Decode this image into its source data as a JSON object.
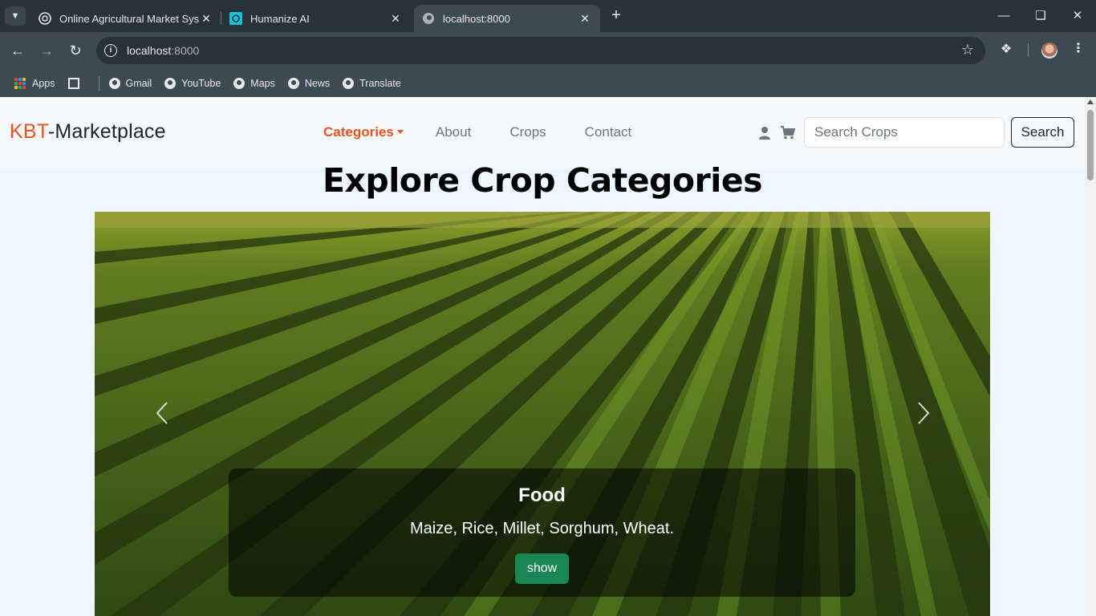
{
  "browser": {
    "tabs": [
      {
        "title": "Online Agricultural Market Syste",
        "favicon": "openai-icon",
        "active": false
      },
      {
        "title": "Humanize AI",
        "favicon": "humanize-icon",
        "active": false
      },
      {
        "title": "localhost:8000",
        "favicon": "globe-icon",
        "active": true
      }
    ],
    "url_host": "localhost",
    "url_port": ":8000",
    "bookmarks": [
      {
        "label": "Apps",
        "icon": "apps-grid-icon"
      },
      {
        "label": "Gmail",
        "icon": "globe-icon"
      },
      {
        "label": "YouTube",
        "icon": "globe-icon"
      },
      {
        "label": "Maps",
        "icon": "globe-icon"
      },
      {
        "label": "News",
        "icon": "globe-icon"
      },
      {
        "label": "Translate",
        "icon": "globe-icon"
      }
    ]
  },
  "site": {
    "brand_prefix": "KBT",
    "brand_suffix": "-Marketplace",
    "nav": [
      {
        "label": "Categories",
        "active": true
      },
      {
        "label": "About"
      },
      {
        "label": "Crops"
      },
      {
        "label": "Contact"
      }
    ],
    "search_placeholder": "Search Crops",
    "search_button": "Search",
    "accent_color": "#e8541c"
  },
  "main": {
    "heading": "Explore Crop Categories",
    "carousel": {
      "slide_title": "Food",
      "slide_text": "Maize, Rice, Millet, Sorghum, Wheat.",
      "button_label": "show",
      "button_color": "#198754"
    }
  }
}
